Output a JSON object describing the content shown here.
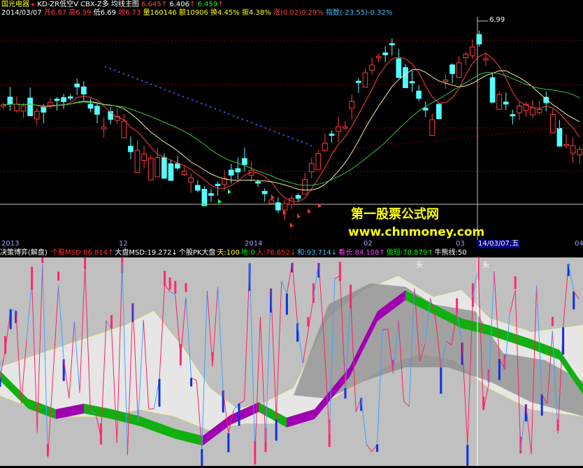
{
  "title_bar": {
    "stock_name": "国光电器",
    "formula_names": "KD-ZR低空V  CBX-Z多  均线主图",
    "ma1": "6.645",
    "ma2": "6.406",
    "ma3": "6.459"
  },
  "info_row": {
    "date": "2014/03/07",
    "open": "开6.87",
    "high": "高6.99",
    "low": "低6.69",
    "close": "收6.73",
    "volume": "量160146",
    "amount": "额10906",
    "turnover": "换4.45%",
    "amplitude": "振4.38%",
    "change": "涨(0.02)0.29%",
    "index": "指数(-23.55)-0.32%"
  },
  "price_marker": "6.99",
  "date_axis": {
    "labels": [
      "2013",
      "12",
      "2014",
      "02",
      "03",
      "04"
    ],
    "cursor_label": "14/03/07,五"
  },
  "watermark": {
    "cn": "第一股票公式网",
    "url": "www.chnmoney.com"
  },
  "sub_header": {
    "name": "决策博弈(解盘)",
    "items": [
      {
        "text": "个股MSD:86.814",
        "arrow": "↑",
        "color": "#ff3030"
      },
      {
        "text": "大盘MSD:19.272",
        "arrow": "↓",
        "color": "#ffffff"
      },
      {
        "text": "个股PK大盘",
        "arrow": "",
        "color": "#ffffff"
      },
      {
        "text": "天:100",
        "arrow": "",
        "color": "#ffff00"
      },
      {
        "text": "地:0",
        "arrow": "",
        "color": "#00ff00"
      },
      {
        "text": "人:76.852",
        "arrow": "↓",
        "color": "#ff3030"
      },
      {
        "text": "和:93.714",
        "arrow": "↓",
        "color": "#40c0ff"
      },
      {
        "text": "看长:84.108",
        "arrow": "↑",
        "color": "#ff40ff"
      },
      {
        "text": "做短:78.879",
        "arrow": "↑",
        "color": "#00ff00"
      },
      {
        "text": "牛熊线:50",
        "arrow": "",
        "color": "#ffffff"
      }
    ]
  },
  "sub_marks": {
    "mark1": "头",
    "mark2": "头"
  }
}
